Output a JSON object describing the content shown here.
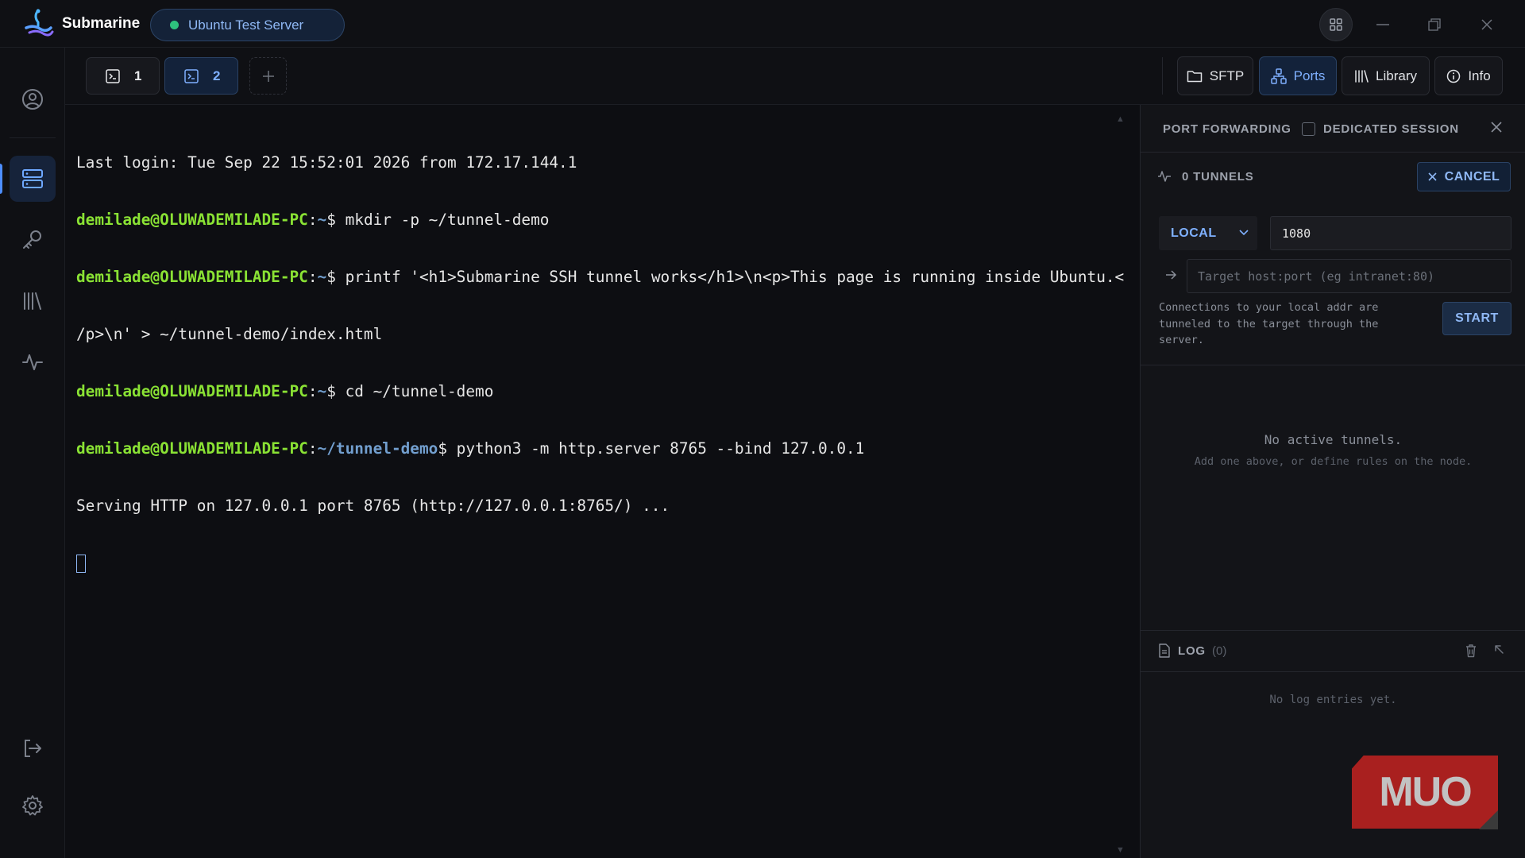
{
  "app": {
    "name": "Submarine",
    "server": "Ubuntu Test Server",
    "server_status_color": "#2ec27e"
  },
  "tabs": [
    {
      "label": "1"
    },
    {
      "label": "2"
    }
  ],
  "toolbar": {
    "sftp": "SFTP",
    "ports": "Ports",
    "library": "Library",
    "info": "Info"
  },
  "sidebar": {
    "items": [
      {
        "icon": "user-circle-icon"
      },
      {
        "icon": "server-icon",
        "active": true
      },
      {
        "icon": "key-icon"
      },
      {
        "icon": "library-icon"
      },
      {
        "icon": "activity-icon"
      }
    ],
    "bottom": [
      {
        "icon": "logout-icon"
      },
      {
        "icon": "gear-icon"
      }
    ]
  },
  "terminal": {
    "lines": [
      {
        "text": "Last login: Tue Sep 22 15:52:01 2026 from 172.17.144.1"
      },
      {
        "user": "demilade@OLUWADEMILADE-PC",
        "path": "~",
        "cmd": " mkdir -p ~/tunnel-demo"
      },
      {
        "user": "demilade@OLUWADEMILADE-PC",
        "path": "~",
        "cmd": " printf '<h1>Submarine SSH tunnel works</h1>\\n<p>This page is running inside Ubuntu.<"
      },
      {
        "text": "/p>\\n' > ~/tunnel-demo/index.html"
      },
      {
        "user": "demilade@OLUWADEMILADE-PC",
        "path": "~",
        "cmd": " cd ~/tunnel-demo"
      },
      {
        "user": "demilade@OLUWADEMILADE-PC",
        "path": "~/tunnel-demo",
        "cmd": " python3 -m http.server 8765 --bind 127.0.0.1"
      },
      {
        "text": "Serving HTTP on 127.0.0.1 port 8765 (http://127.0.0.1:8765/) ..."
      }
    ]
  },
  "panel": {
    "title": "PORT FORWARDING",
    "dedicated_label": "DEDICATED SESSION",
    "tunnels_label": "0 TUNNELS",
    "cancel_label": "CANCEL",
    "mode": "LOCAL",
    "port_value": "1080",
    "target_placeholder": "Target host:port (eg intranet:80)",
    "help": "Connections to your local addr are tunneled to the target through the server.",
    "start_label": "START",
    "empty_title": "No active tunnels.",
    "empty_sub": "Add one above, or define rules on the node.",
    "log_title": "LOG",
    "log_count": "(0)",
    "log_empty": "No log entries yet."
  },
  "watermark": "MUO",
  "colors": {
    "accent": "#4d8eff",
    "prompt_user": "#8ae234",
    "prompt_path": "#729fcf",
    "background": "#0d0e12"
  }
}
